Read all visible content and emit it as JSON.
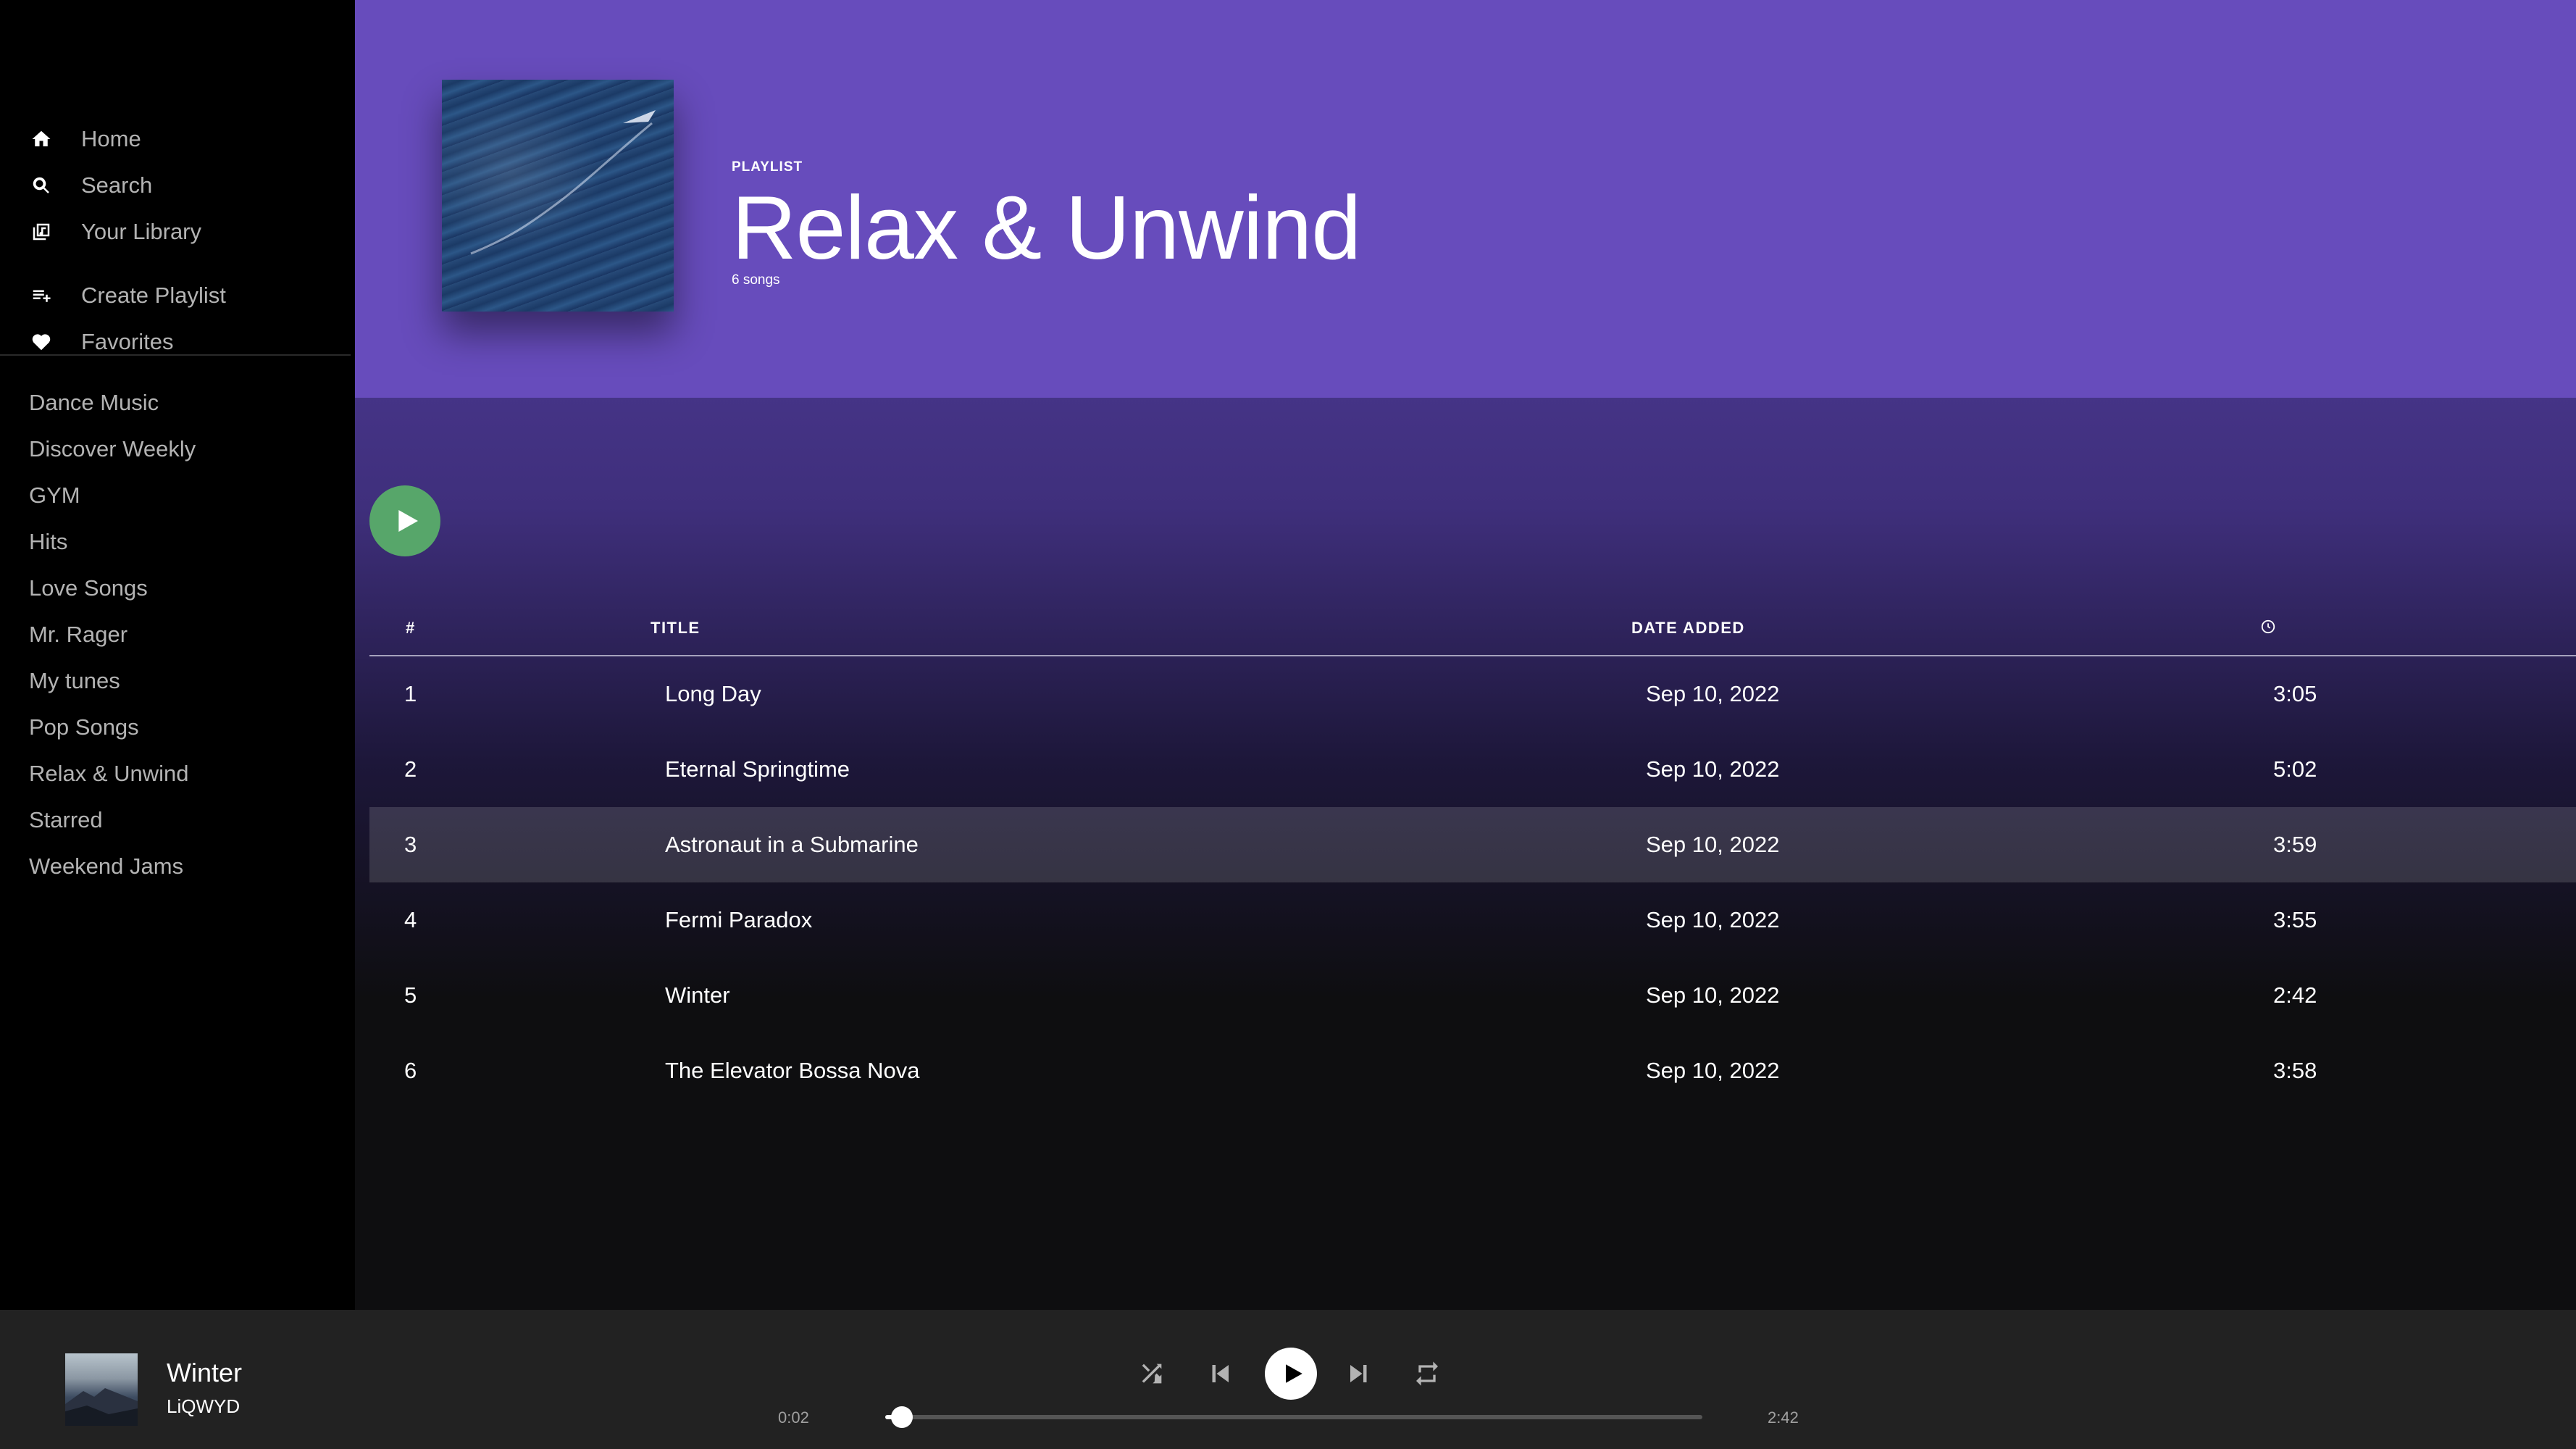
{
  "nav": {
    "main": [
      {
        "label": "Home",
        "icon": "home-icon"
      },
      {
        "label": "Search",
        "icon": "search-icon"
      },
      {
        "label": "Your Library",
        "icon": "library-icon"
      }
    ],
    "secondary": [
      {
        "label": "Create Playlist",
        "icon": "add-playlist-icon"
      },
      {
        "label": "Favorites",
        "icon": "heart-icon"
      }
    ]
  },
  "playlists": [
    "Dance Music",
    "Discover Weekly",
    "GYM",
    "Hits",
    "Love Songs",
    "Mr. Rager",
    "My tunes",
    "Pop Songs",
    "Relax & Unwind",
    "Starred",
    "Weekend Jams"
  ],
  "header": {
    "type": "PLAYLIST",
    "title": "Relax & Unwind",
    "song_count": "6 songs"
  },
  "table": {
    "columns": {
      "num": "#",
      "title": "TITLE",
      "date": "DATE ADDED",
      "duration_icon": "clock-icon"
    },
    "rows": [
      {
        "num": "1",
        "title": "Long Day",
        "date": "Sep 10, 2022",
        "duration": "3:05"
      },
      {
        "num": "2",
        "title": "Eternal Springtime",
        "date": "Sep 10, 2022",
        "duration": "5:02"
      },
      {
        "num": "3",
        "title": "Astronaut in a Submarine",
        "date": "Sep 10, 2022",
        "duration": "3:59"
      },
      {
        "num": "4",
        "title": "Fermi Paradox",
        "date": "Sep 10, 2022",
        "duration": "3:55"
      },
      {
        "num": "5",
        "title": "Winter",
        "date": "Sep 10, 2022",
        "duration": "2:42"
      },
      {
        "num": "6",
        "title": "The Elevator Bossa Nova",
        "date": "Sep 10, 2022",
        "duration": "3:58"
      }
    ],
    "selected_row": 3
  },
  "player": {
    "track": "Winter",
    "artist": "LiQWYD",
    "current_time": "0:02",
    "total_time": "2:42",
    "progress_fraction": 0.012
  },
  "colors": {
    "header_bg": "#674cbc",
    "play_button": "#57a66a",
    "sidebar_bg": "#000000",
    "player_bg": "#222222"
  }
}
